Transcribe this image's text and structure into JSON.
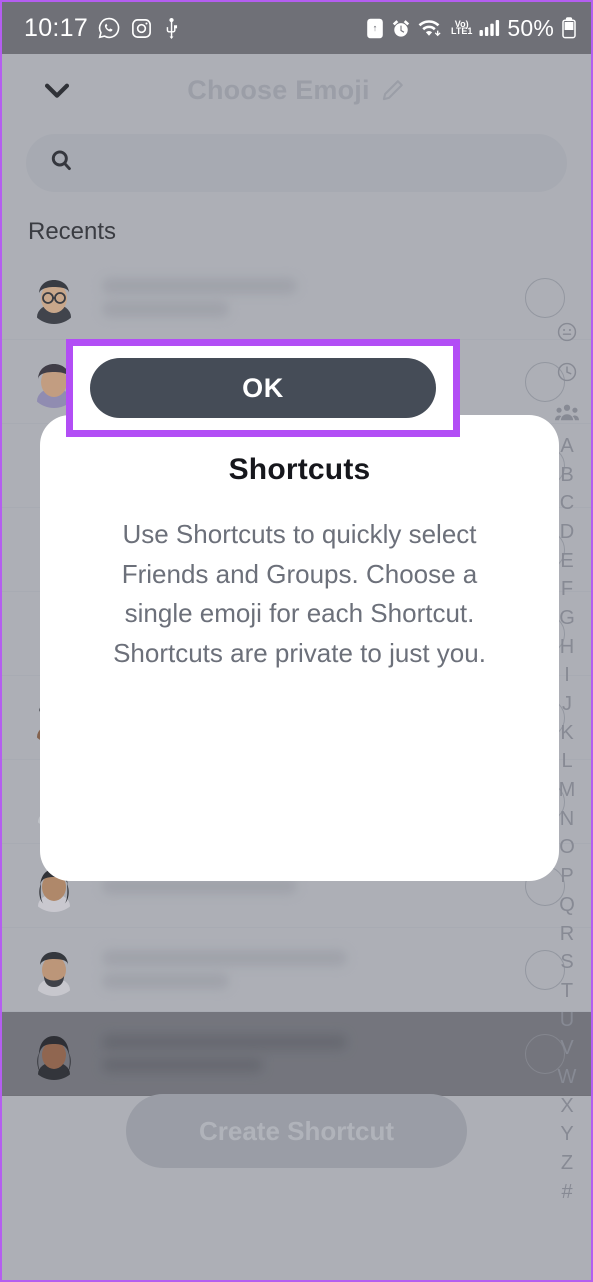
{
  "statusbar": {
    "time": "10:17",
    "battery": "50%",
    "network_label_top": "Vo)",
    "network_label_bottom": "LTE1",
    "icons": [
      "whatsapp-icon",
      "instagram-icon",
      "usb-icon",
      "screenshot-save-icon",
      "alarm-icon",
      "wifi-icon",
      "volte-icon",
      "signal-icon",
      "battery-icon"
    ]
  },
  "header": {
    "title": "Choose Emoji",
    "edit_icon": "pencil-icon",
    "back_icon": "chevron-down-icon"
  },
  "search": {
    "placeholder": "",
    "value": "",
    "icon": "search-icon"
  },
  "sections": {
    "recents_label": "Recents"
  },
  "index_rail": {
    "icons": [
      "smiley-icon",
      "clock-icon",
      "group-icon"
    ],
    "letters": [
      "A",
      "B",
      "C",
      "D",
      "E",
      "F",
      "G",
      "H",
      "I",
      "J",
      "K",
      "L",
      "M",
      "N",
      "O",
      "P",
      "Q",
      "R",
      "S",
      "T",
      "U",
      "V",
      "W",
      "X",
      "Y",
      "Z",
      "#"
    ]
  },
  "create_shortcut": {
    "label": "Create Shortcut"
  },
  "dialog": {
    "title": "Shortcuts",
    "body": "Use Shortcuts to quickly select Friends and Groups. Choose a single emoji for each Shortcut. Shortcuts are private to just you.",
    "ok_label": "OK"
  },
  "annotation": {
    "highlight_color": "#b24ef5",
    "target": "ok-button"
  },
  "colors": {
    "accent_purple": "#b24ef5",
    "button_dark": "#454c57",
    "app_background": "#c2c4cb",
    "statusbar": "#6f7077",
    "dialog_background": "#ffffff",
    "body_text": "#6c707a"
  },
  "list_rows": [
    {
      "avatar": "bitmoji-glasses-dark-hair",
      "selected": false
    },
    {
      "avatar": "bitmoji-long-hair",
      "selected": false
    },
    {
      "avatar": "bitmoji-hidden",
      "selected": false
    },
    {
      "avatar": "bitmoji-hidden",
      "selected": false
    },
    {
      "avatar": "bitmoji-hidden",
      "selected": false
    },
    {
      "avatar": "bitmoji-glasses-beard",
      "selected": false
    },
    {
      "avatar": "bitmoji-bun-beard",
      "selected": false
    },
    {
      "avatar": "bitmoji-woman-dark-hair",
      "selected": false
    },
    {
      "avatar": "bitmoji-beard-wink",
      "selected": false
    },
    {
      "avatar": "bitmoji-woman-long-hair",
      "selected": false
    }
  ]
}
